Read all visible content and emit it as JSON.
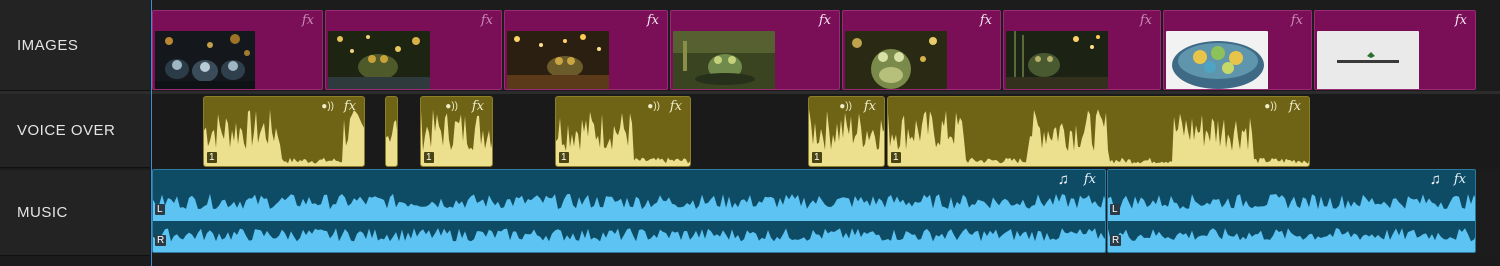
{
  "tracks": {
    "images": {
      "label": "IMAGES"
    },
    "voice_over": {
      "label": "VOICE OVER"
    },
    "music": {
      "label": "MUSIC"
    }
  },
  "clip_labels": {
    "fx": "fx",
    "voice_channel": "1",
    "music_left": "L",
    "music_right": "R"
  },
  "image_clips": [
    {
      "thumb": "frogs-helmets-bokeh"
    },
    {
      "thumb": "frog-in-water-bokeh"
    },
    {
      "thumb": "frog-on-log-sparks"
    },
    {
      "thumb": "frog-swimming"
    },
    {
      "thumb": "frog-standing-portrait"
    },
    {
      "thumb": "frog-reeds-bokeh"
    },
    {
      "thumb": "frogs-in-bowl"
    },
    {
      "thumb": "logo-white-card"
    }
  ],
  "thumb_logo_text": "wusgandlabe",
  "colors": {
    "images_clip": "#7a0f57",
    "voice_clip": "#6f6416",
    "voice_wave": "#ece08e",
    "music_clip": "#0e4c66",
    "music_wave": "#5cc3f2",
    "playhead": "#3b8fd6"
  }
}
